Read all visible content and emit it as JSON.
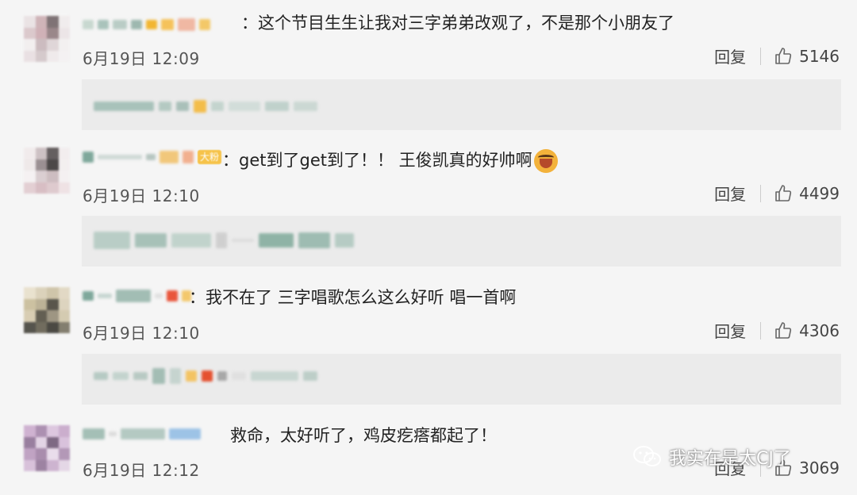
{
  "comments": [
    {
      "content": "：这个节目生生让我对三字弟弟改观了，不是那个小朋友了",
      "time": "6月19日 12:09",
      "reply": "回复",
      "likes": "5146"
    },
    {
      "content": "：get到了get到了！！ 王俊凯真的好帅啊",
      "time": "6月19日 12:10",
      "reply": "回复",
      "likes": "4499",
      "badge": "大粉",
      "emoji": "crying-laughing-emoji"
    },
    {
      "content": "：我不在了  三字唱歌怎么这么好听 唱一首啊",
      "time": "6月19日 12:10",
      "reply": "回复",
      "likes": "4306"
    },
    {
      "content": "救命，太好听了，鸡皮疙瘩都起了！",
      "time": "6月19日 12:12",
      "reply": "回复",
      "likes": "3069"
    }
  ],
  "watermark": {
    "text": "我实在是太CJ了",
    "icon": "wechat-official-account-icon"
  },
  "colors": {
    "background": "#f5f5f5",
    "reply_box": "#ebebeb",
    "text": "#222222",
    "meta": "#555555"
  }
}
